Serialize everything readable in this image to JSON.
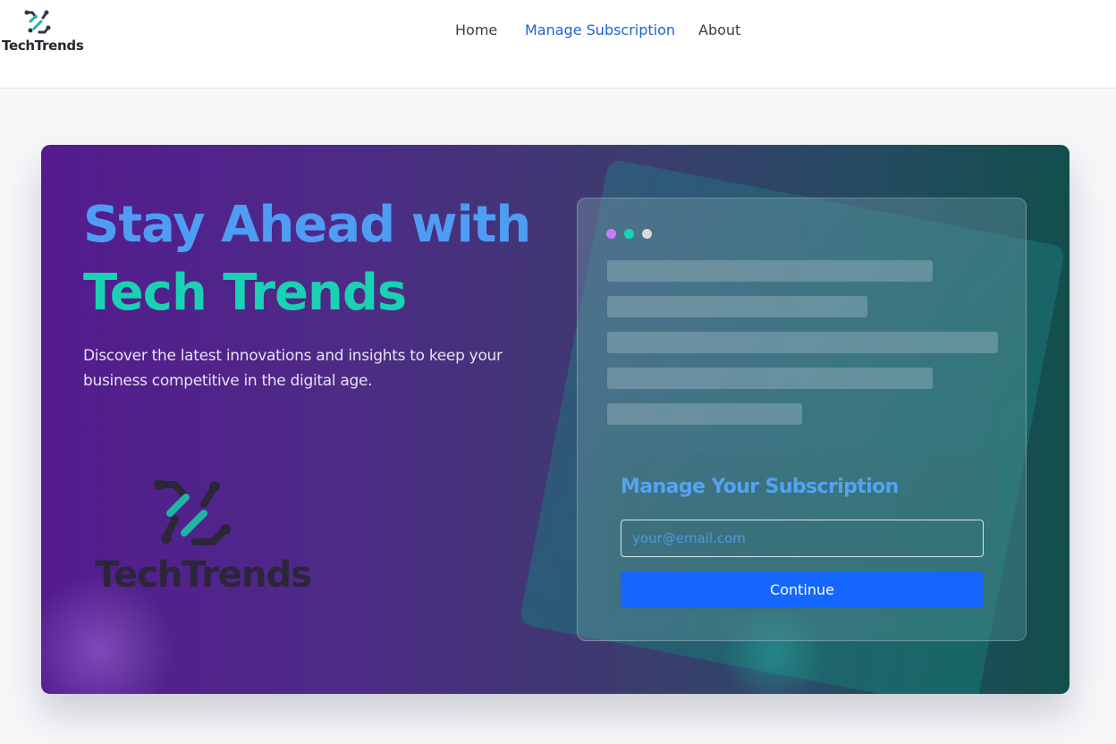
{
  "brand": {
    "name": "TechTrends",
    "logo_icon": "techtrends-logo-icon"
  },
  "nav": {
    "items": [
      {
        "label": "Home",
        "active": false
      },
      {
        "label": "Manage Subscription",
        "active": true
      },
      {
        "label": "About",
        "active": false
      }
    ]
  },
  "hero": {
    "title_line1": "Stay Ahead with",
    "title_line2": "Tech Trends",
    "subtitle": "Discover the latest innovations and insights to keep your business competitive in the digital age.",
    "watermark_logo_text": "TechTrends"
  },
  "subscription": {
    "title": "Manage Your Subscription",
    "email_placeholder": "your@email.com",
    "email_value": "",
    "continue_label": "Continue"
  },
  "colors": {
    "accent_blue": "#4f9cf5",
    "accent_teal": "#19d2b4",
    "button_blue": "#1566ff",
    "nav_active": "#1f63d6",
    "window_dots": [
      "#c77dff",
      "#19d2b4",
      "#d9d9d9"
    ]
  }
}
